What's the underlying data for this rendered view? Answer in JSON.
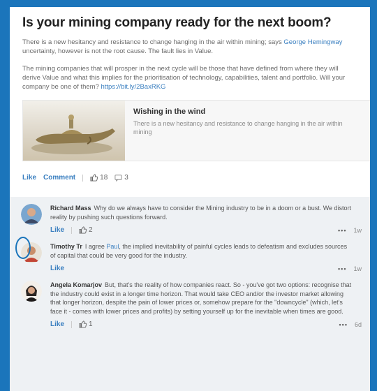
{
  "post": {
    "title": "Is your mining company ready for the next boom?",
    "para1_a": "There is a new hesitancy and resistance to change hanging in the air within mining; says ",
    "para1_link": "George Hemingway",
    "para1_b": " uncertainty, however is not the root cause. The fault lies in Value.",
    "para2_a": "The mining companies that will prosper in the next cycle will be those that have defined from where they will derive Value and what this implies for the prioritisation of technology, capabilities, talent and portfolio. Will your company be one of them? ",
    "para2_link": "https://bit.ly/2BaxRKG",
    "card_title": "Wishing in the wind",
    "card_desc": "There is a new hesitancy and resistance to change hanging in the air within mining",
    "like_label": "Like",
    "comment_label": "Comment",
    "likes_count": "18",
    "comments_count": "3"
  },
  "comments": [
    {
      "author": "Richard Mass",
      "text": "Why do we always have to consider the Mining industry to be in a doom or a bust. We distort reality by pushing such questions forward.",
      "like_label": "Like",
      "likes": "2",
      "menu": "•••",
      "time": "1w"
    },
    {
      "author": "Timothy Tr",
      "text_a": "I agree ",
      "mention": "Paul",
      "text_b": ", the implied inevitability of painful cycles leads to defeatism and excludes sources of capital that could be very good for the industry.",
      "like_label": "Like",
      "menu": "•••",
      "time": "1w"
    },
    {
      "author": "Angela Komarjov",
      "text": "But, that's the reality of how companies react. So - you've got two options: recognise that the industry could exist in a longer time horizon. That would take CEO and/or the investor market allowing that longer horizon, despite the pain of lower prices or, somehow prepare for the \"downcycle\" (which, let's face it - comes with lower prices and profits) by setting yourself up for the inevitable when times are good.",
      "like_label": "Like",
      "likes": "1",
      "menu": "•••",
      "time": "6d"
    }
  ],
  "colors": {
    "frame": "#1b75bb",
    "link": "#3a7fc0"
  },
  "icons": {
    "like": "thumbs-up-icon",
    "comment": "comment-icon",
    "menu": "more-icon"
  }
}
